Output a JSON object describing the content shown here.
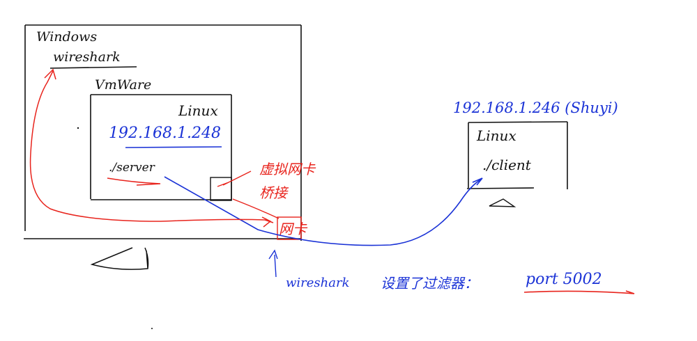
{
  "windows_host": {
    "os_label": "Windows",
    "app_label": "wireshark",
    "vm_label": "VmWare"
  },
  "linux_vm": {
    "os_label": "Linux",
    "ip": "192.168.1.248",
    "program": "./server"
  },
  "virtual_nic": {
    "label": "虚拟网卡",
    "mode": "桥接"
  },
  "gateway": {
    "label": "网卡"
  },
  "remote_linux": {
    "ip_header": "192.168.1.246 (Shuyi)",
    "os_label": "Linux",
    "program": "./client"
  },
  "note": {
    "prefix": "wireshark",
    "middle": "设置了过滤器：",
    "filter": "port 5002"
  },
  "colors": {
    "ink": "#111111",
    "blue": "#1a32d6",
    "red": "#e8231c"
  }
}
